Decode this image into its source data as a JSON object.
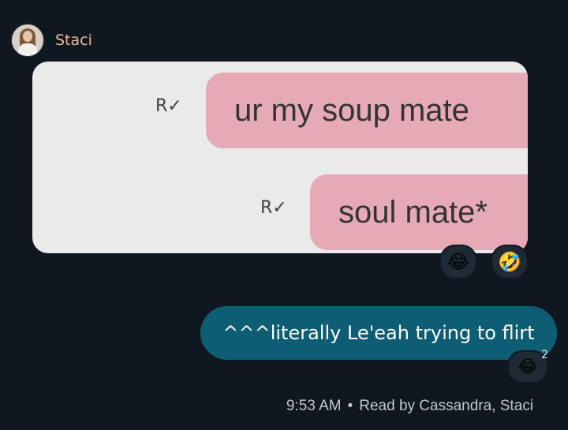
{
  "conversation": {
    "sender": {
      "name": "Staci",
      "avatar_icon": "profile-photo-icon",
      "name_color": "#f2b89a"
    },
    "attachment": {
      "bubbles": [
        {
          "text": "ur my soup mate",
          "status_icon": "R-check"
        },
        {
          "text": "soul mate*",
          "status_icon": "R-check"
        }
      ],
      "status_glyph": "R✓",
      "reactions": [
        "😂",
        "🤣"
      ]
    },
    "outgoing": {
      "text": "^^^literally Le'eah trying to flirt",
      "reaction": "😂",
      "reaction_count": "2",
      "bubble_color": "#0d5d74"
    },
    "status": {
      "time": "9:53 AM",
      "separator": "•",
      "read_by": "Read by Cassandra, Staci"
    }
  }
}
